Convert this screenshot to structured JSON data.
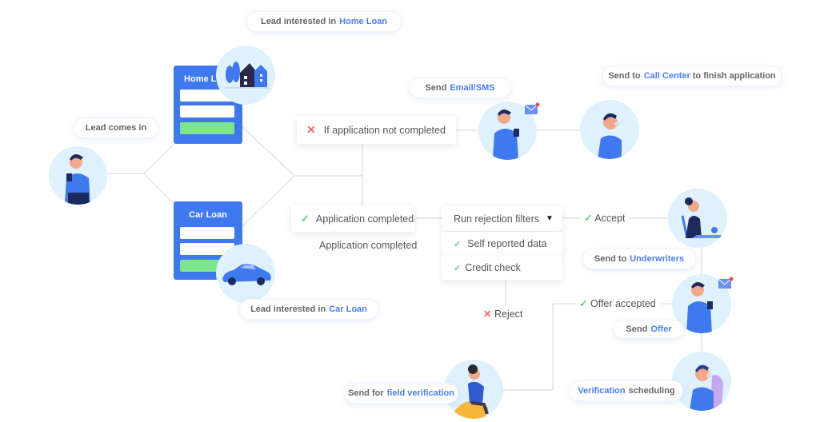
{
  "bubbles": {
    "home_loan": {
      "prefix": "Lead interested in",
      "highlight": "Home  Loan"
    },
    "lead_comes_in": {
      "text": "Lead comes in"
    },
    "car_loan": {
      "prefix": "Lead interested in",
      "highlight": "Car  Loan"
    },
    "email_sms": {
      "prefix": "Send",
      "highlight": "Email/SMS"
    },
    "call_center": {
      "prefix": "Send to",
      "highlight": "Call Center",
      "suffix": "to finish application"
    },
    "underwriters": {
      "prefix": "Send to",
      "highlight": "Underwriters"
    },
    "offer": {
      "prefix": "Send",
      "highlight": "Offer"
    },
    "field_verification": {
      "prefix": "Send for",
      "highlight": "field verification"
    },
    "verification_scheduling": {
      "highlight": "Verification",
      "suffix": "scheduling"
    }
  },
  "forms": {
    "home": {
      "title": "Home Loan"
    },
    "car": {
      "title": "Car Loan"
    }
  },
  "cards": {
    "not_completed": {
      "icon": "x-icon",
      "text": "If application not completed"
    },
    "completed": {
      "icon": "check-icon",
      "text": "Application completed"
    },
    "completed_label": "Application completed",
    "rejection_filters": {
      "text": "Run rejection filters",
      "icon": "filter-icon"
    },
    "self_reported": {
      "icon": "check-icon",
      "text": "Self reported data"
    },
    "credit_check": {
      "icon": "check-icon",
      "text": "Credit check"
    }
  },
  "edges": {
    "accept": {
      "icon": "check-icon",
      "text": "Accept"
    },
    "reject": {
      "icon": "x-icon",
      "text": "Reject"
    },
    "offer_accepted": {
      "icon": "check-icon",
      "text": "Offer accepted"
    }
  },
  "symbols": {
    "x": "✕",
    "check": "✓",
    "filter": "▼"
  },
  "colors": {
    "accent": "#4a7ef2",
    "form_blue": "#3f79f0",
    "form_button": "#7ee58f",
    "circle_bg": "#dff1fd",
    "reject_red": "#ef6b6b",
    "accept_green": "#5fd07a"
  }
}
